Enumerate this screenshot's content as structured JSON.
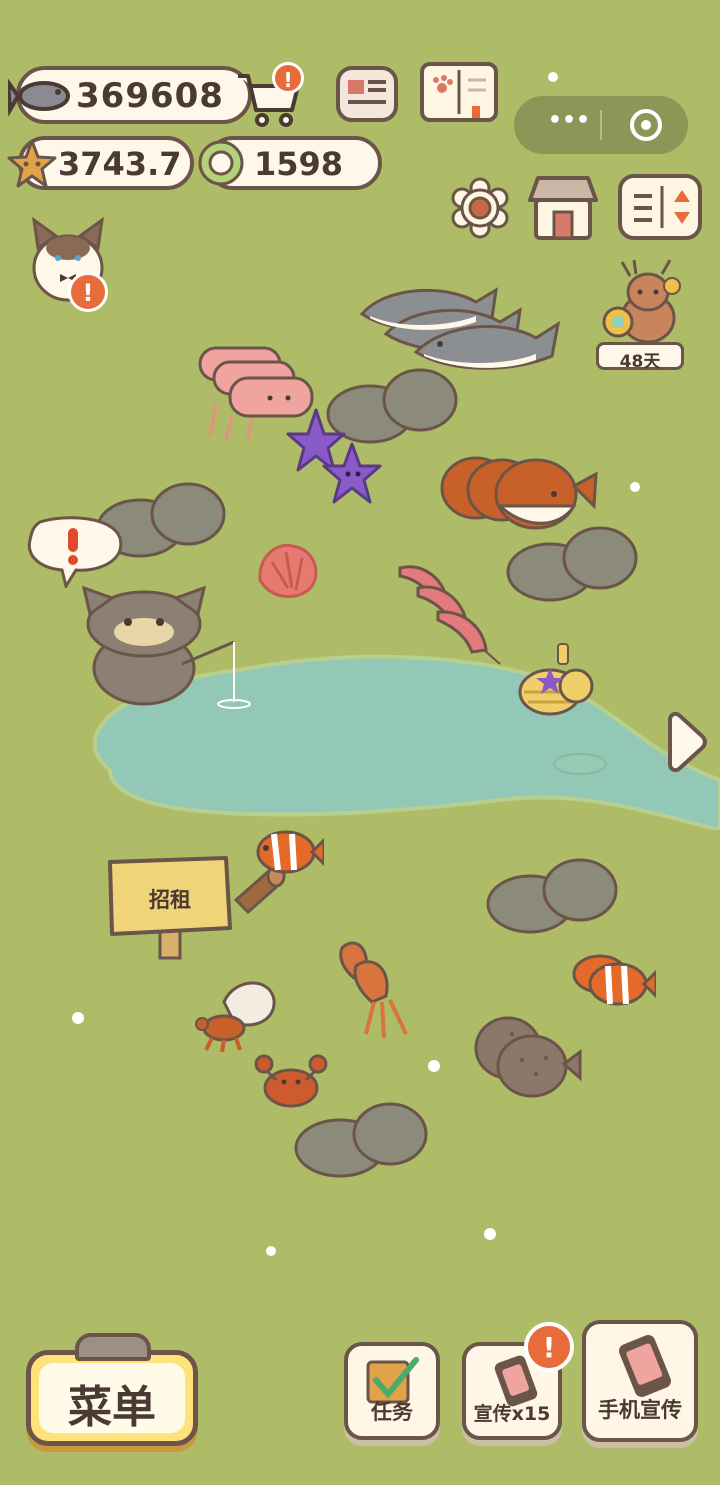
{
  "hud": {
    "fish_amount": "369608",
    "star_amount": "3743.7",
    "token_amount": "1598",
    "icons": [
      "fish-icon",
      "cart-icon",
      "newspaper-icon",
      "album-icon",
      "star-icon",
      "token-icon",
      "settings-icon",
      "shop-icon",
      "sort-icon"
    ],
    "miniprogram": {
      "more": "•••"
    }
  },
  "event": {
    "days_left": "48天"
  },
  "pond": {
    "sign_text": "招租"
  },
  "bottom": {
    "menu_label": "菜单",
    "task_label": "任务",
    "promo_label": "宣传x15",
    "phone_promo_label": "手机宣传"
  },
  "colors": {
    "grass": "#aebb67",
    "water": "#93c7b6",
    "accent": "#e86b3a",
    "outline": "#6b5548",
    "menu_yellow": "#ffe27a"
  }
}
